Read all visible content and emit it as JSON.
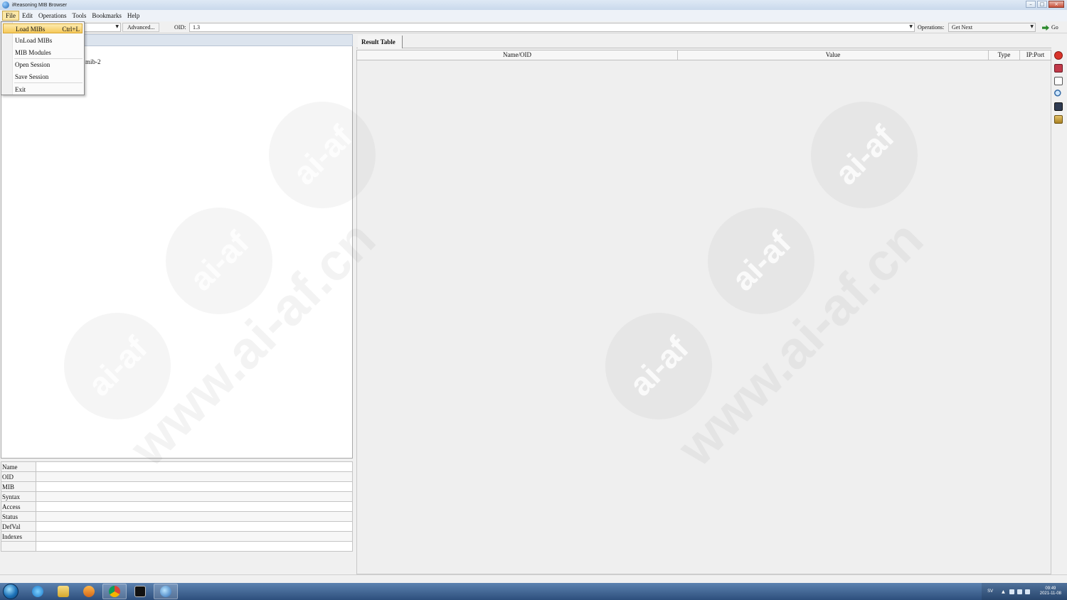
{
  "window": {
    "title": "iReasoning MIB Browser",
    "controls": [
      "minimize",
      "maximize",
      "close"
    ]
  },
  "menubar": [
    "File",
    "Edit",
    "Operations",
    "Tools",
    "Bookmarks",
    "Help"
  ],
  "file_menu": {
    "items": [
      {
        "label": "Load MIBs",
        "shortcut": "Ctrl+L",
        "highlighted": true
      },
      {
        "label": "UnLoad MIBs"
      },
      {
        "label": "MIB Modules"
      },
      {
        "label": "Open Session"
      },
      {
        "label": "Save Session"
      },
      {
        "label": "Exit"
      }
    ]
  },
  "toolbar": {
    "advanced_label": "Advanced...",
    "oid_label": "OID:",
    "oid_value": "1.3",
    "operations_label": "Operations:",
    "operations_value": "Get Next",
    "go_label": "Go"
  },
  "tree": {
    "visible_node_fragment": "mib-2"
  },
  "properties": {
    "rows": [
      "Name",
      "OID",
      "MIB",
      "Syntax",
      "Access",
      "Status",
      "DefVal",
      "Indexes",
      ""
    ]
  },
  "result": {
    "tab_label": "Result Table",
    "columns": [
      "Name/OID",
      "Value",
      "Type",
      "IP:Port"
    ]
  },
  "side_toolbar": [
    "stop-icon",
    "clear-icon",
    "new-document-icon",
    "find-icon",
    "save-icon",
    "open-folder-icon"
  ],
  "taskbar": {
    "apps": [
      "internet-explorer-icon",
      "folder-icon",
      "media-player-icon",
      "chrome-icon",
      "cmd-icon",
      "mib-browser-icon"
    ],
    "language": "SV",
    "time": "09:49",
    "date": "2021-11-08"
  },
  "watermark": {
    "badge_text": "ai-af",
    "url_text": "www.ai-af.cn"
  },
  "colors": {
    "menu_highlight": "#f6c95a",
    "titlebar": "#c9d9ec",
    "taskbar": "#2d4f7c"
  }
}
